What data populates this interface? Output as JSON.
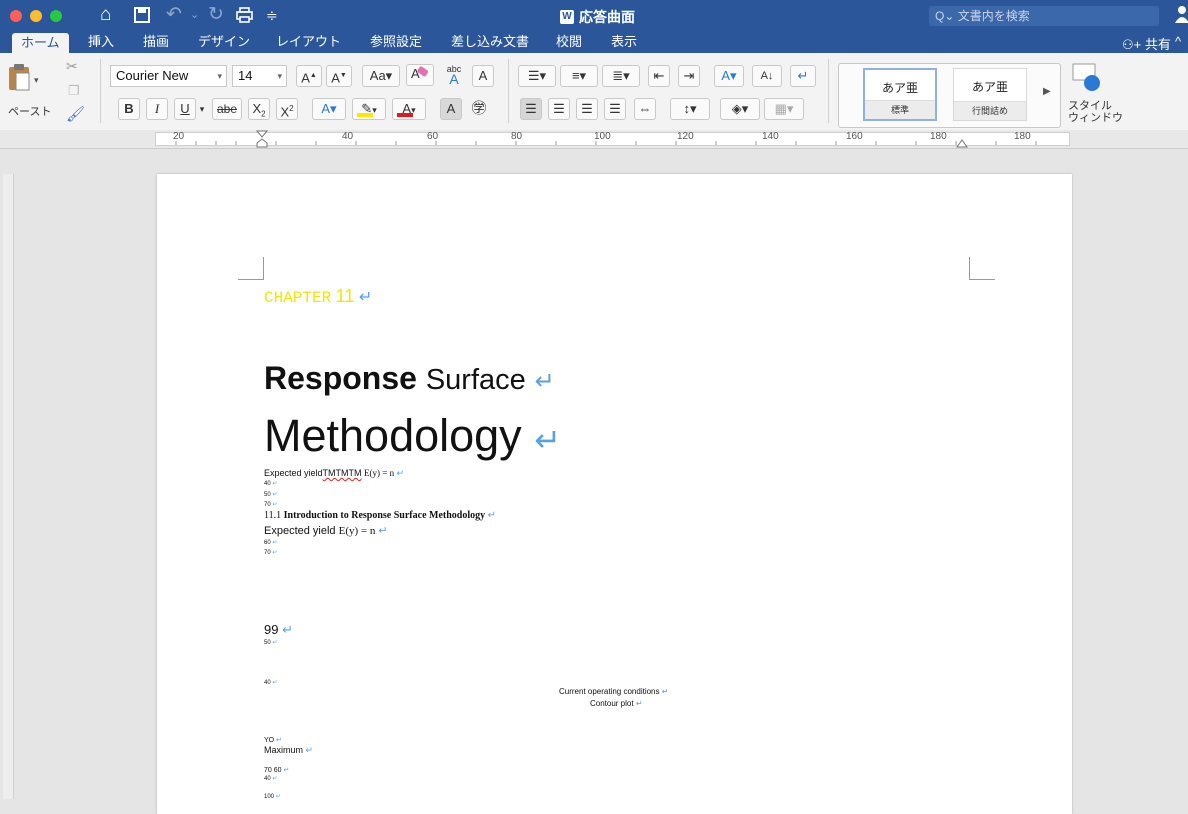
{
  "titlebar": {
    "doc_title": "応答曲面",
    "doc_icon": "W",
    "search_placeholder": "文書内を検索",
    "search_icon": "Q⌄"
  },
  "tabs": [
    "ホーム",
    "挿入",
    "描画",
    "デザイン",
    "レイアウト",
    "参照設定",
    "差し込み文書",
    "校閲",
    "表示"
  ],
  "share_label": "共有",
  "ribbon": {
    "paste_label": "ペースト",
    "font_name": "Courier New",
    "font_size": "14",
    "style_gallery": [
      {
        "preview": "あア亜",
        "name": "標準"
      },
      {
        "preview": "あア亜",
        "name": "行間詰め"
      }
    ],
    "styles_pane_label_line1": "スタイル",
    "styles_pane_label_line2": "ウィンドウ"
  },
  "ruler_ticks": [
    "20",
    "20",
    "40",
    "60",
    "80",
    "100",
    "120",
    "140",
    "160",
    "180"
  ],
  "document": {
    "chapter_word": "CHAPTER",
    "chapter_number": "11",
    "title_bold": "Response",
    "title_rest": "Surface",
    "title_line2": "Methodology",
    "line_a_text": "Expected yield",
    "line_a_squiggle": "TMTMTM",
    "line_a_formula": "E(y) = n",
    "line_40": "40",
    "line_50": "50",
    "line_70": "70",
    "section_number": "11.1",
    "section_title": "Introduction to Response Surface Methodology",
    "line_b_text": "Expected yield",
    "line_b_formula": "E(y) = n",
    "line_60": "60",
    "line_70b": "70",
    "page_num": "99",
    "line_50b": "50",
    "line_40b": "40",
    "current_conditions": "Current operating conditions",
    "contour_plot": "Contour plot",
    "yo": "YO",
    "maximum": "Maximum",
    "line_7060": "70 60",
    "line_40c": "40",
    "line_100": "100"
  },
  "colors": {
    "title_bar": "#2b579a",
    "chapter_text": "#f2e600",
    "paragraph_mark": "#5aa0e6",
    "highlight_yellow": "#ffe600",
    "font_red": "#e01b1b"
  }
}
